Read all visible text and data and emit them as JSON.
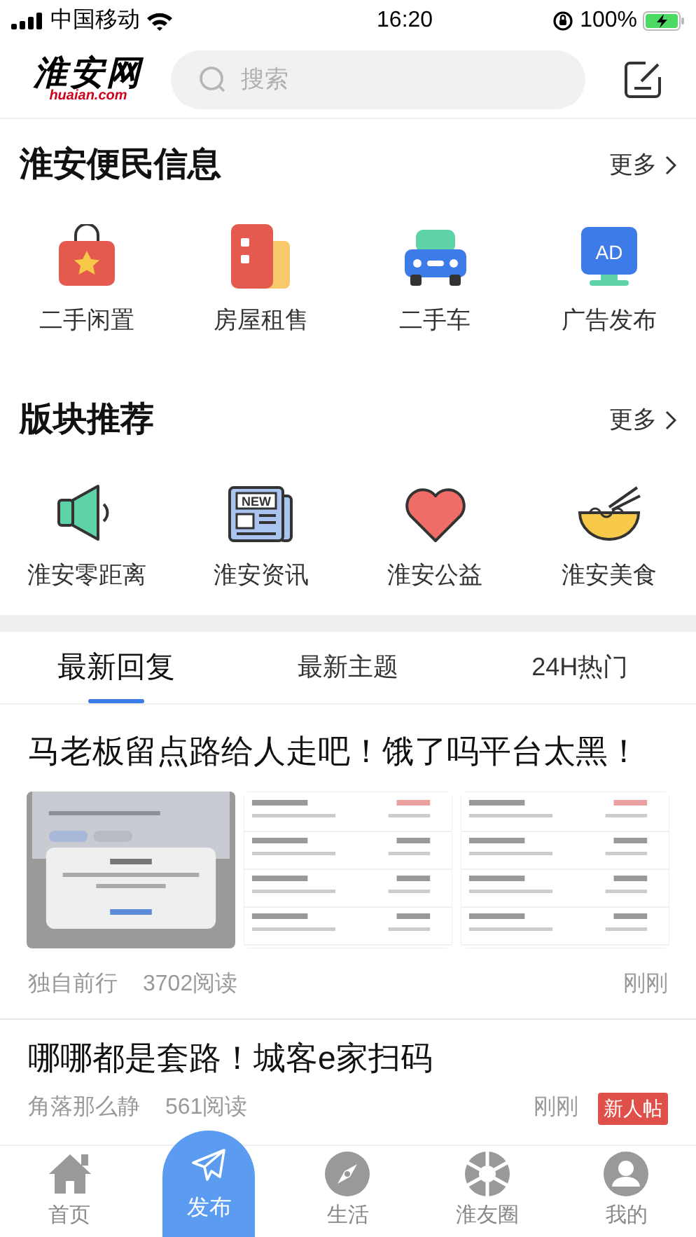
{
  "status_bar": {
    "carrier": "中国移动",
    "time": "16:20",
    "battery": "100%"
  },
  "header": {
    "logo": {
      "mark": "淮安网",
      "domain": "huaian.com"
    },
    "search": {
      "placeholder": "搜索"
    }
  },
  "sections": [
    {
      "title": "淮安便民信息",
      "more": "更多",
      "items": [
        {
          "label": "二手闲置",
          "kind": "bag"
        },
        {
          "label": "房屋租售",
          "kind": "house"
        },
        {
          "label": "二手车",
          "kind": "car"
        },
        {
          "label": "广告发布",
          "kind": "ad",
          "icon_text": "AD"
        }
      ]
    },
    {
      "title": "版块推荐",
      "more": "更多",
      "items": [
        {
          "label": "淮安零距离",
          "kind": "speaker"
        },
        {
          "label": "淮安资讯",
          "kind": "news",
          "icon_text": "NEW"
        },
        {
          "label": "淮安公益",
          "kind": "heart"
        },
        {
          "label": "淮安美食",
          "kind": "bowl"
        }
      ]
    }
  ],
  "feed_tabs": [
    {
      "label": "最新回复",
      "selected": true
    },
    {
      "label": "最新主题",
      "selected": false
    },
    {
      "label": "24H热门",
      "selected": false
    }
  ],
  "posts": [
    {
      "title": "马老板留点路给人走吧！饿了吗平台太黑！",
      "author": "独自前行",
      "reads": "3702阅读",
      "time": "刚刚"
    },
    {
      "title": "哪哪都是套路！城客e家扫码",
      "author": "角落那么静",
      "reads": "561阅读",
      "time": "刚刚",
      "badge": "新人帖"
    }
  ],
  "bottom_nav": [
    {
      "label": "首页",
      "kind": "home"
    },
    {
      "label": "发布",
      "kind": "publish"
    },
    {
      "label": "生活",
      "kind": "compass"
    },
    {
      "label": "淮友圈",
      "kind": "aperture"
    },
    {
      "label": "我的",
      "kind": "person"
    }
  ]
}
